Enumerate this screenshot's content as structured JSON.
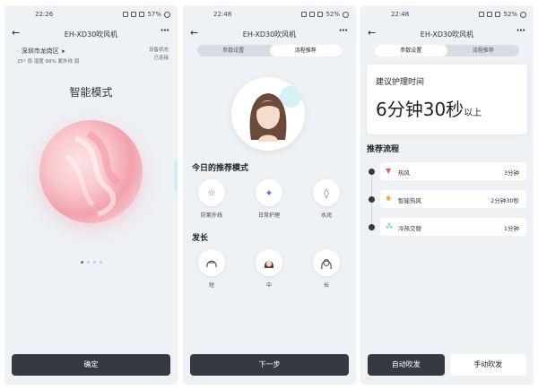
{
  "status": {
    "p1": {
      "time": "22:26",
      "battery": "57%"
    },
    "p2": {
      "time": "22:48",
      "battery": "52%"
    },
    "p3": {
      "time": "22:48",
      "battery": "52%"
    }
  },
  "app_title": "EH-XD30吹风机",
  "more_icon": "⋯",
  "back_icon": "←",
  "phone1": {
    "location": "深圳市龙岗区",
    "weather": "25°  雨  湿度 99%  紫外线  弱",
    "device_state_label": "设备状态",
    "device_state_value": "已连接",
    "mode_title": "智能模式",
    "confirm_button": "确定",
    "carousel_pages": 4,
    "carousel_active": 1
  },
  "phone2": {
    "tabs": [
      "参数设置",
      "流程推荐"
    ],
    "selected_tab": 1,
    "today_mode_title": "今日的推荐模式",
    "modes": [
      {
        "label": "防紫外线",
        "icon": "sun-shield-icon"
      },
      {
        "label": "日常护理",
        "icon": "hair-dryer-icon"
      },
      {
        "label": "水润",
        "icon": "water-drops-icon"
      }
    ],
    "hair_length_title": "发长",
    "lengths": [
      {
        "label": "短",
        "icon": "short-hair-icon"
      },
      {
        "label": "中",
        "icon": "medium-hair-icon"
      },
      {
        "label": "长",
        "icon": "long-hair-icon"
      }
    ],
    "next_button": "下一步"
  },
  "phone3": {
    "tabs": [
      "参数设置",
      "流程推荐"
    ],
    "selected_tab": 1,
    "care_time_label": "建议护理时间",
    "care_time_value": "6分钟30秒",
    "care_time_suffix": "以上",
    "flow_title": "推荐流程",
    "steps": [
      {
        "name": "热风",
        "duration": "3分钟",
        "icon": "hot-air-icon"
      },
      {
        "name": "智能热风",
        "duration": "2分钟30秒",
        "icon": "smart-hot-air-icon"
      },
      {
        "name": "冷热交替",
        "duration": "1分钟",
        "icon": "cold-hot-alternate-icon"
      }
    ],
    "auto_button": "自动吹发",
    "manual_button": "手动吹发"
  },
  "colors": {
    "phone_bg": "#eef1f5",
    "dark_button": "#353940",
    "orb_pink": "#f2a1ab"
  }
}
